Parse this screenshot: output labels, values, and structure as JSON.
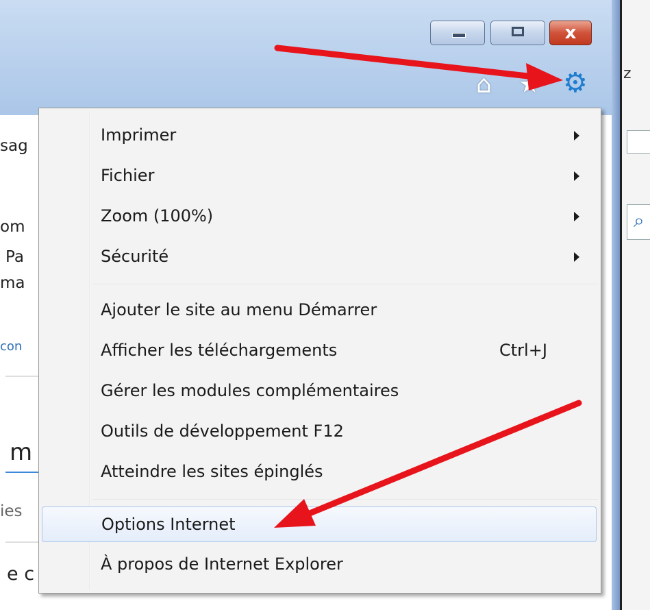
{
  "window": {
    "controls": {
      "minimize_icon": "minimize-icon",
      "maximize_icon": "maximize-icon",
      "close_icon": "close-icon",
      "close_glyph": "x"
    },
    "toolbar_icons": [
      "home-icon",
      "star-icon",
      "gear-icon"
    ],
    "accent_gear_color": "#1f7ccf"
  },
  "background_page": {
    "fragments": [
      "sag",
      "om",
      "Pa",
      "ma",
      "con",
      "m",
      "ies",
      "e c"
    ]
  },
  "right_side": {
    "fragments": [
      "z"
    ]
  },
  "menu": {
    "items": [
      {
        "label": "Imprimer",
        "submenu": true
      },
      {
        "label": "Fichier",
        "submenu": true
      },
      {
        "label": "Zoom (100%)",
        "submenu": true
      },
      {
        "label": "Sécurité",
        "submenu": true
      },
      {
        "label": "Ajouter le site au menu Démarrer"
      },
      {
        "label": "Afficher les téléchargements",
        "shortcut": "Ctrl+J"
      },
      {
        "label": "Gérer les modules complémentaires"
      },
      {
        "label": "Outils de développement F12"
      },
      {
        "label": "Atteindre les sites épinglés"
      },
      {
        "label": "Options Internet",
        "highlighted": true
      },
      {
        "label": "À propos de Internet Explorer"
      }
    ]
  },
  "annotation_color": "#e8141c"
}
